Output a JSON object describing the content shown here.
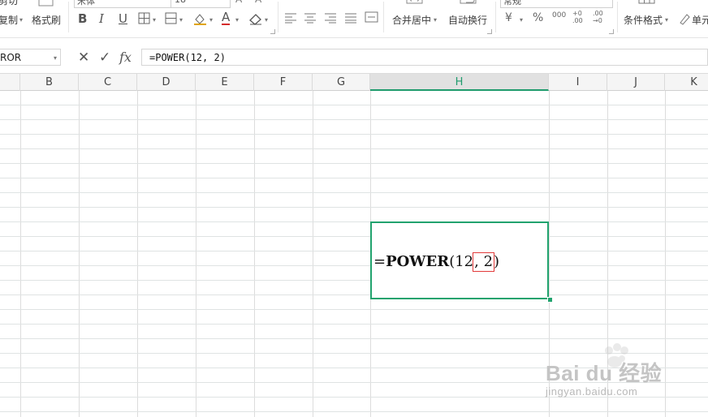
{
  "ribbon": {
    "clipboard": {
      "top_label": "剪切",
      "copy_label": "复制",
      "copy_caret": "▾",
      "format_painter_label": "格式刷"
    },
    "font": {
      "font_name": "宋体",
      "font_size": "18",
      "bold": "B",
      "italic": "I",
      "underline": "U",
      "font_color_letter": "A",
      "grow_font": "A⁺",
      "shrink_font": "A⁻"
    },
    "alignment": {
      "merge_center_label": "合并居中",
      "wrap_text_label": "自动换行",
      "caret": "▾"
    },
    "number": {
      "format_value": "常规",
      "currency_symbol": "¥",
      "percent_symbol": "%",
      "thousands_symbol": "000",
      "increase_decimal": "+0 .00",
      "decrease_decimal": ".00 →0"
    },
    "styles": {
      "conditional_format_label": "条件格式",
      "caret": "▾",
      "cell_style_label": "单元"
    }
  },
  "formula_bar": {
    "name_box_value": "ROR",
    "cancel_symbol": "✕",
    "enter_symbol": "✓",
    "fx_symbol": "fx",
    "formula": "=POWER(12, 2)"
  },
  "grid": {
    "columns": [
      "B",
      "C",
      "D",
      "E",
      "F",
      "G",
      "H",
      "I",
      "J",
      "K"
    ],
    "active_column": "H",
    "active_cell": {
      "prefix": "=",
      "function_name": "POWER",
      "open_paren": "(",
      "arg1": "12",
      "separator_and_arg2": ", 2",
      "close_paren": ")"
    }
  },
  "watermark": {
    "brand_text": "Bai du 经验",
    "url_text": "jingyan.baidu.com"
  },
  "colors": {
    "selection": "#22a36e",
    "highlight_box": "#e23a3a",
    "active_header_text": "#1f9b6d"
  }
}
